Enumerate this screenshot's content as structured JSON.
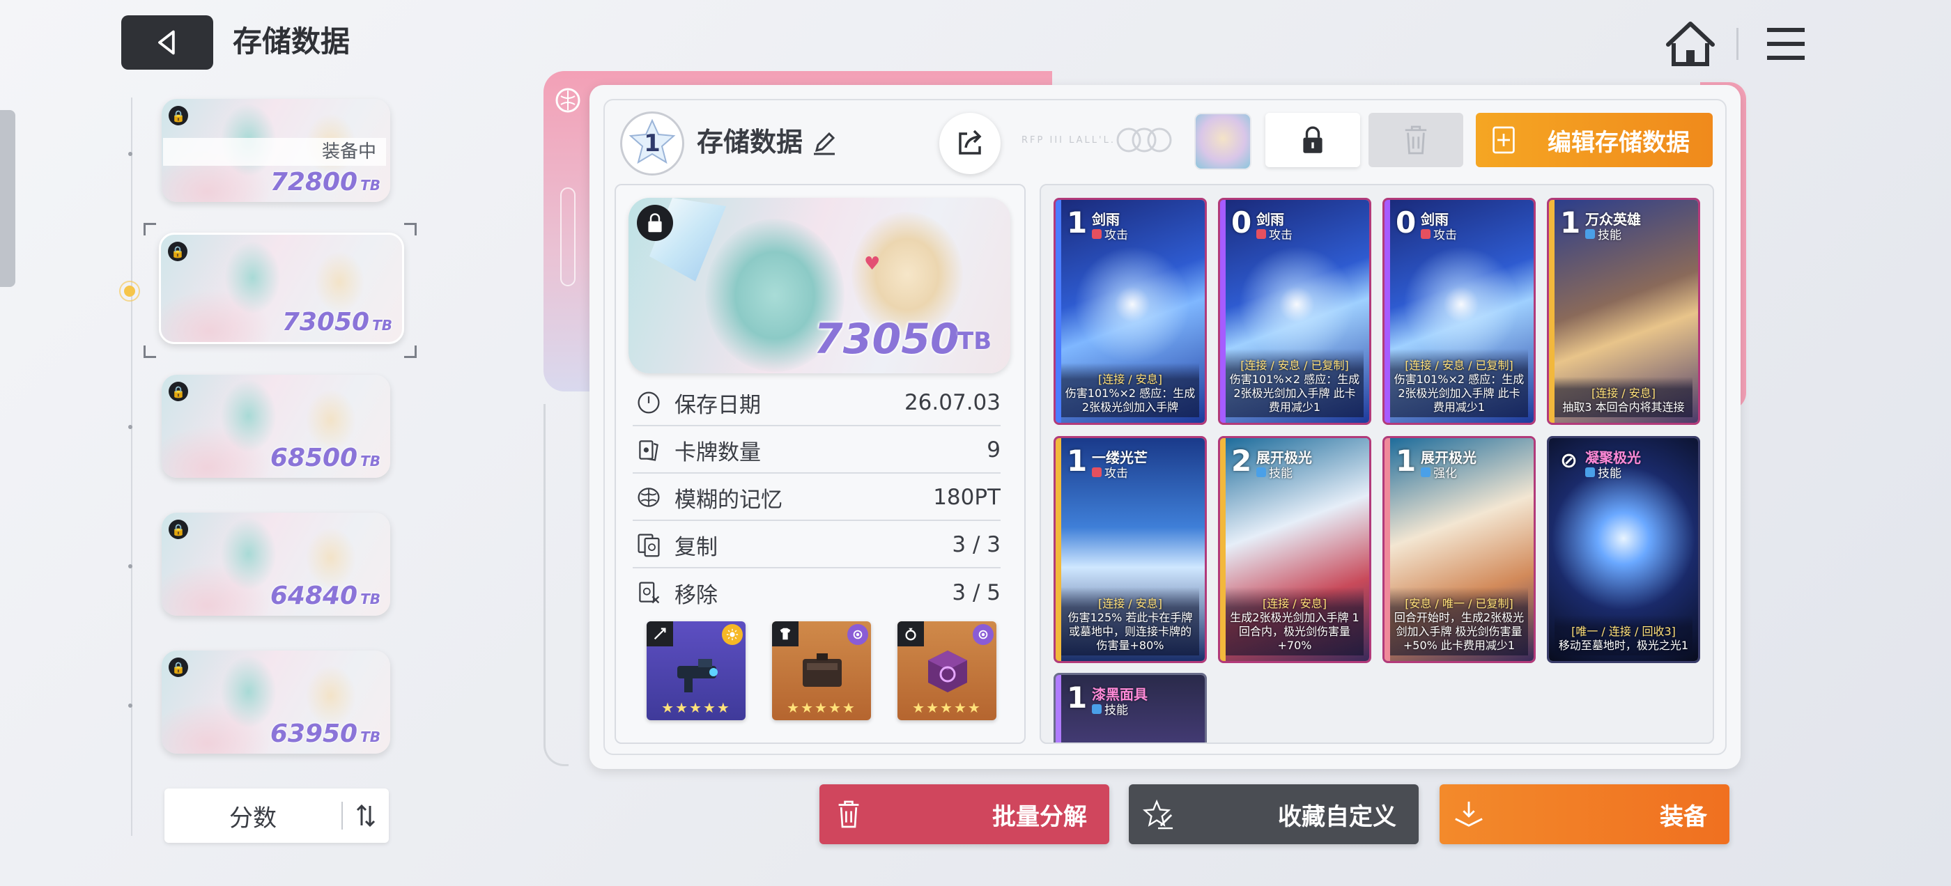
{
  "header": {
    "title": "存储数据"
  },
  "saves": [
    {
      "score": "72800",
      "unit": "TB",
      "equipped_label": "装备中",
      "selected": false
    },
    {
      "score": "73050",
      "unit": "TB",
      "selected": true
    },
    {
      "score": "68500",
      "unit": "TB",
      "selected": false
    },
    {
      "score": "64840",
      "unit": "TB",
      "selected": false
    },
    {
      "score": "63950",
      "unit": "TB",
      "selected": false
    }
  ],
  "sort": {
    "label": "分数"
  },
  "detail": {
    "slot": "1",
    "name": "存储数据",
    "deco_text": "RFP III LALL'L.",
    "edit_button": "编辑存储数据",
    "score": "73050",
    "unit": "TB",
    "info": [
      {
        "icon": "clock-icon",
        "label": "保存日期",
        "value": "26.07.03"
      },
      {
        "icon": "cards-icon",
        "label": "卡牌数量",
        "value": "9"
      },
      {
        "icon": "brain-icon",
        "label": "模糊的记忆",
        "value": "180PT"
      },
      {
        "icon": "copy-icon",
        "label": "复制",
        "value": "3 / 3"
      },
      {
        "icon": "remove-icon",
        "label": "移除",
        "value": "3 / 5"
      }
    ],
    "equipment": [
      {
        "slot": "weapon",
        "stars": "★★★★★",
        "rank_color": "#f6b826",
        "bg": "#5a4ab8"
      },
      {
        "slot": "armor",
        "stars": "★★★★★",
        "rank_color": "#8a5cd6",
        "bg": "#c7763a"
      },
      {
        "slot": "ring",
        "stars": "★★★★★",
        "rank_color": "#8a5cd6",
        "bg": "#c7763a"
      }
    ]
  },
  "cards": [
    {
      "cost": "1",
      "name": "剑雨",
      "type": "攻击",
      "type_color": "#e5505f",
      "theme": "blue",
      "tag": "[连接 / 安息]",
      "desc": "伤害101%×2 感应：生成2张极光剑加入手牌"
    },
    {
      "cost": "0",
      "name": "剑雨",
      "type": "攻击",
      "type_color": "#e5505f",
      "theme": "blue",
      "tag": "[连接 / 安息 / 已复制]",
      "desc": "伤害101%×2 感应：生成2张极光剑加入手牌 此卡费用减少1"
    },
    {
      "cost": "0",
      "name": "剑雨",
      "type": "攻击",
      "type_color": "#e5505f",
      "theme": "blue",
      "tag": "[连接 / 安息 / 已复制]",
      "desc": "伤害101%×2 感应：生成2张极光剑加入手牌 此卡费用减少1"
    },
    {
      "cost": "1",
      "name": "万众英雄",
      "type": "技能",
      "type_color": "#4aa0e8",
      "theme": "gold",
      "tag": "[连接 / 安息]",
      "desc": "抽取3 本回合内将其连接"
    },
    {
      "cost": "1",
      "name": "一缕光芒",
      "type": "攻击",
      "type_color": "#e5505f",
      "theme": "ice",
      "tag": "[连接 / 安息]",
      "desc": "伤害125% 若此卡在手牌或墓地中，则连接卡牌的伤害量+80%"
    },
    {
      "cost": "2",
      "name": "展开极光",
      "type": "技能",
      "type_color": "#4aa0e8",
      "theme": "red",
      "tag": "[连接 / 安息]",
      "desc": "生成2张极光剑加入手牌 1回合内，极光剑伤害量+70%"
    },
    {
      "cost": "1",
      "name": "展开极光",
      "type": "强化",
      "type_color": "#4aa0e8",
      "theme": "red",
      "tag": "[安息 / 唯一 / 已复制]",
      "desc": "回合开始时，生成2张极光剑加入手牌 极光剑伤害量+50% 此卡费用减少1"
    },
    {
      "cost": "⊘",
      "name": "凝聚极光",
      "type": "技能",
      "type_color": "#4aa0e8",
      "theme": "dark",
      "tag": "[唯一 / 连接 / 回收3]",
      "desc": "移动至墓地时，极光之光1"
    },
    {
      "cost": "1",
      "name": "漆黑面具",
      "type": "技能",
      "type_color": "#4aa0e8",
      "theme": "night",
      "tag": "",
      "desc": ""
    }
  ],
  "actions": {
    "batch": "批量分解",
    "favorite": "收藏自定义",
    "equip": "装备"
  }
}
